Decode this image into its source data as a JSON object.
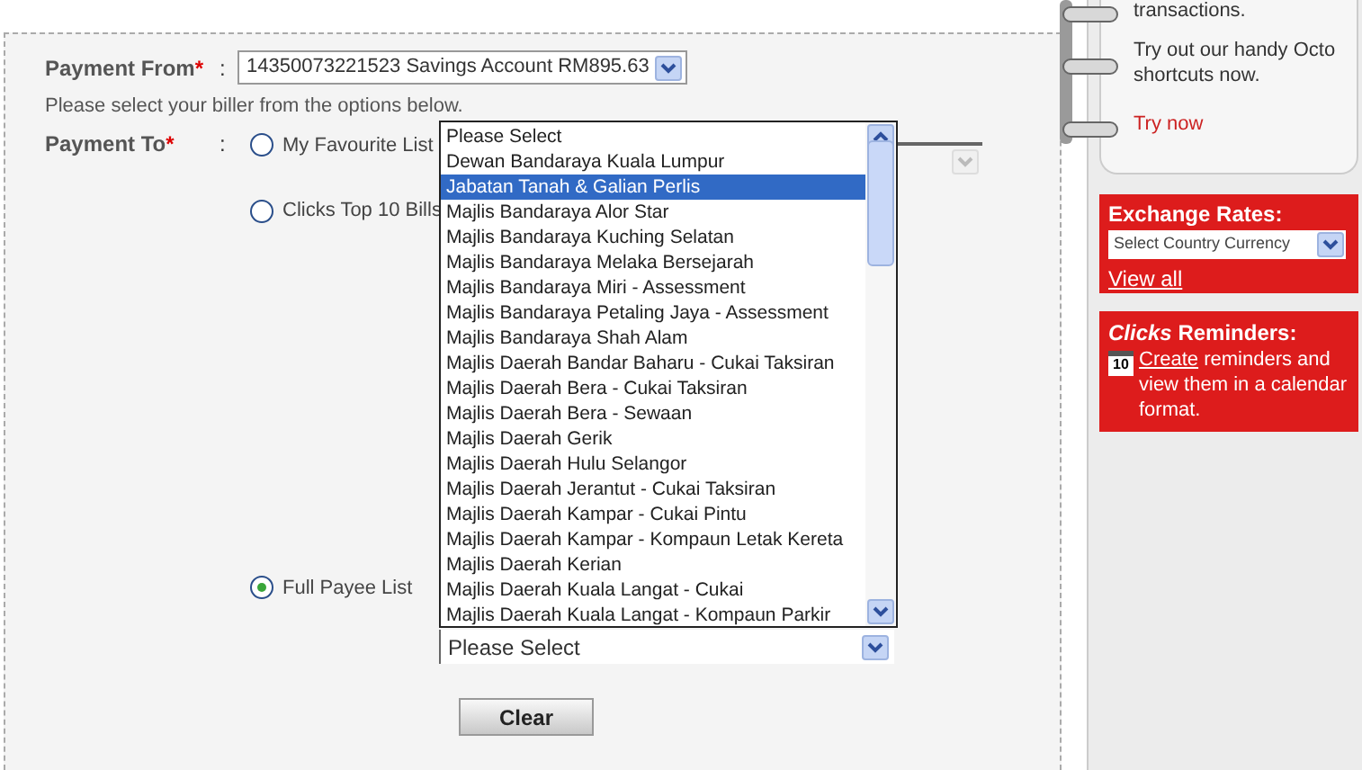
{
  "payment_from": {
    "label": "Payment From",
    "required_mark": "*",
    "colon": ":",
    "value": "14350073221523 Savings Account RM895.63"
  },
  "instruction": "Please select your biller from the options below.",
  "payment_to": {
    "label": "Payment To",
    "required_mark": "*",
    "colon": ":",
    "options": [
      {
        "label": "My Favourite List",
        "selected": false
      },
      {
        "label": "Clicks Top 10 Bills",
        "selected": false
      },
      {
        "label": "Full Payee List",
        "selected": true
      }
    ],
    "favourite_select": {
      "disabled": true
    },
    "payee_select": {
      "value": "Please Select"
    },
    "payee_list": [
      {
        "label": "Please Select",
        "selected": false
      },
      {
        "label": "Dewan Bandaraya Kuala Lumpur",
        "selected": false
      },
      {
        "label": "Jabatan Tanah & Galian Perlis",
        "selected": true
      },
      {
        "label": "Majlis Bandaraya Alor Star",
        "selected": false
      },
      {
        "label": "Majlis Bandaraya Kuching Selatan",
        "selected": false
      },
      {
        "label": "Majlis Bandaraya Melaka Bersejarah",
        "selected": false
      },
      {
        "label": "Majlis Bandaraya Miri - Assessment",
        "selected": false
      },
      {
        "label": "Majlis Bandaraya Petaling Jaya - Assessment",
        "selected": false
      },
      {
        "label": "Majlis Bandaraya Shah Alam",
        "selected": false
      },
      {
        "label": "Majlis Daerah Bandar Baharu - Cukai Taksiran",
        "selected": false
      },
      {
        "label": "Majlis Daerah Bera - Cukai Taksiran",
        "selected": false
      },
      {
        "label": "Majlis Daerah Bera - Sewaan",
        "selected": false
      },
      {
        "label": "Majlis Daerah Gerik",
        "selected": false
      },
      {
        "label": "Majlis Daerah Hulu Selangor",
        "selected": false
      },
      {
        "label": "Majlis Daerah Jerantut - Cukai Taksiran",
        "selected": false
      },
      {
        "label": "Majlis Daerah Kampar - Cukai Pintu",
        "selected": false
      },
      {
        "label": "Majlis Daerah Kampar - Kompaun Letak Kereta",
        "selected": false
      },
      {
        "label": "Majlis Daerah Kerian",
        "selected": false
      },
      {
        "label": "Majlis Daerah Kuala Langat - Cukai",
        "selected": false
      },
      {
        "label": "Majlis Daerah Kuala Langat - Kompaun Parkir",
        "selected": false
      }
    ]
  },
  "clear_button": "Clear",
  "sidebar": {
    "promo": {
      "cut_line": "transactions.",
      "text": "Try out our handy Octo shortcuts now.",
      "link": "Try now"
    },
    "exchange": {
      "title": "Exchange Rates:",
      "select": "Select Country Currency",
      "link": "View all"
    },
    "reminders": {
      "title": "*Clicks* Reminders:",
      "icon_day": "10",
      "link": "Create",
      "text": "reminders and view them in a calendar format."
    }
  }
}
